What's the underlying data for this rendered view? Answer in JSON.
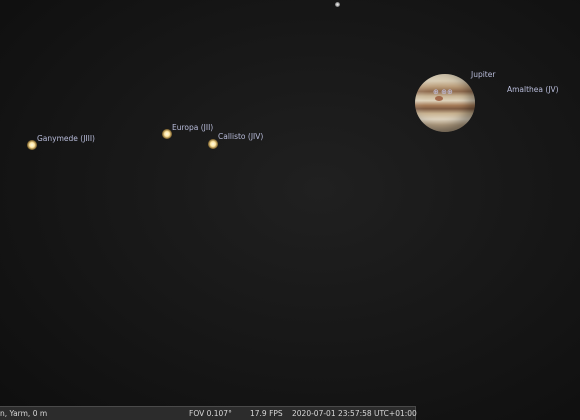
{
  "objects": {
    "jupiter": {
      "label": "Jupiter",
      "marker_text": "⊕ ⊕⊕"
    },
    "amalthea": {
      "label": "Amalthea (JV)"
    },
    "europa": {
      "label": "Europa (JII)"
    },
    "callisto": {
      "label": "Callisto (JIV)"
    },
    "ganymede": {
      "label": "Ganymede (JIII)"
    }
  },
  "status_bar": {
    "location": "n, Yarm, 0 m",
    "fov": "FOV 0.107°",
    "fps": "17.9 FPS",
    "datetime": "2020-07-01 23:57:58 UTC+01:00"
  }
}
